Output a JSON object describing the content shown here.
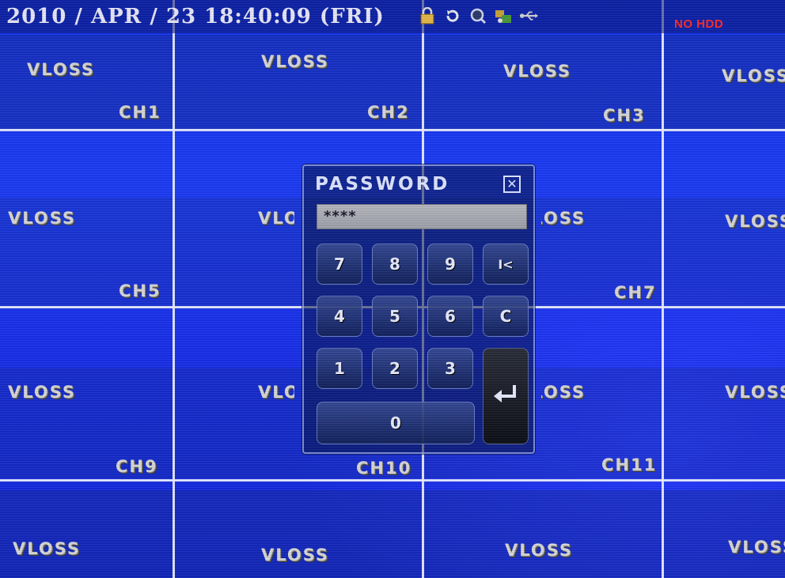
{
  "status_bar": {
    "datetime": "2010 / APR / 23  18:40:09 (FRI)",
    "icons": [
      "lock-icon",
      "refresh-icon",
      "search-icon",
      "network-icon",
      "usb-icon"
    ],
    "hdd_status": "NO HDD",
    "hdd_status_color": "#ff2a2a"
  },
  "channels": {
    "vloss_label": "VLOSS",
    "names": [
      "CH1",
      "CH2",
      "CH3",
      "CH5",
      "CH7",
      "CH9",
      "CH10",
      "CH11"
    ]
  },
  "dialog": {
    "title": "PASSWORD",
    "close_icon": "close-icon",
    "password_value": "****",
    "keys": {
      "k7": "7",
      "k8": "8",
      "k9": "9",
      "backspace": "I<",
      "k4": "4",
      "k5": "5",
      "k6": "6",
      "clear": "C",
      "k1": "1",
      "k2": "2",
      "k3": "3",
      "k0": "0"
    },
    "enter_icon": "enter-icon"
  },
  "colors": {
    "background": "#1a2fe8",
    "grid_line": "#ebf0ff",
    "text": "#d8d8d8"
  }
}
